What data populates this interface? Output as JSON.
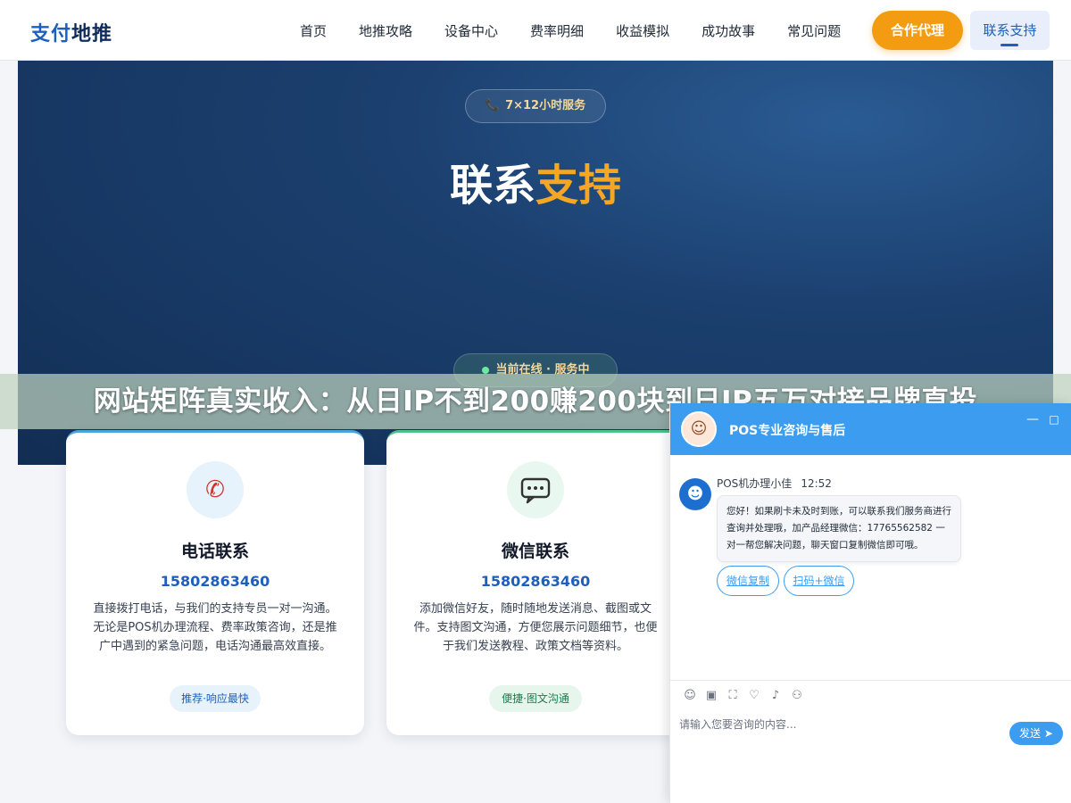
{
  "header": {
    "logo_part1": "支付",
    "logo_part2": "地推",
    "nav": [
      "首页",
      "地推攻略",
      "设备中心",
      "费率明细",
      "收益模拟",
      "成功故事",
      "常见问题"
    ],
    "partner_button": "合作代理",
    "active_tab": "联系支持"
  },
  "hero": {
    "badge_icon": "📞",
    "badge_text": "7×12小时服务",
    "title_white": "联系",
    "title_orange": "支持",
    "online_text": "当前在线 · 服务中"
  },
  "banner": {
    "text": "网站矩阵真实收入：从日IP不到200赚200块到日IP五万对接品牌直投"
  },
  "cards": [
    {
      "icon": "phone-icon",
      "title": "电话联系",
      "number": "15802863460",
      "text": "直接拨打电话，与我们的支持专员一对一沟通。无论是POS机办理流程、费率政策咨询，还是推广中遇到的紧急问题，电话沟通最高效直接。",
      "tag": "推荐·响应最快"
    },
    {
      "icon": "chat-icon",
      "title": "微信联系",
      "number": "15802863460",
      "text": "添加微信好友，随时随地发送消息、截图或文件。支持图文沟通，方便您展示问题细节，也便于我们发送教程、政策文档等资料。",
      "tag": "便捷·图文沟通"
    }
  ],
  "chat": {
    "title": "POS专业咨询与售后",
    "agent_name": "POS机办理小佳",
    "time": "12:52",
    "message": "您好！如果刷卡未及时到账，可以联系我们服务商进行查询并处理哦，加产品经理微信：17765562582 一对一帮您解决问题，聊天窗口复制微信即可哦。",
    "btn_copy": "微信复制",
    "btn_scan": "扫码+微信",
    "input_placeholder": "请输入您要咨询的内容...",
    "send_label": "发送",
    "accent_color": "#3b9cf0"
  },
  "colors": {
    "brand_blue": "#1d5fbf",
    "orange": "#f39c12",
    "hero_bg": "#1b3f6e"
  }
}
